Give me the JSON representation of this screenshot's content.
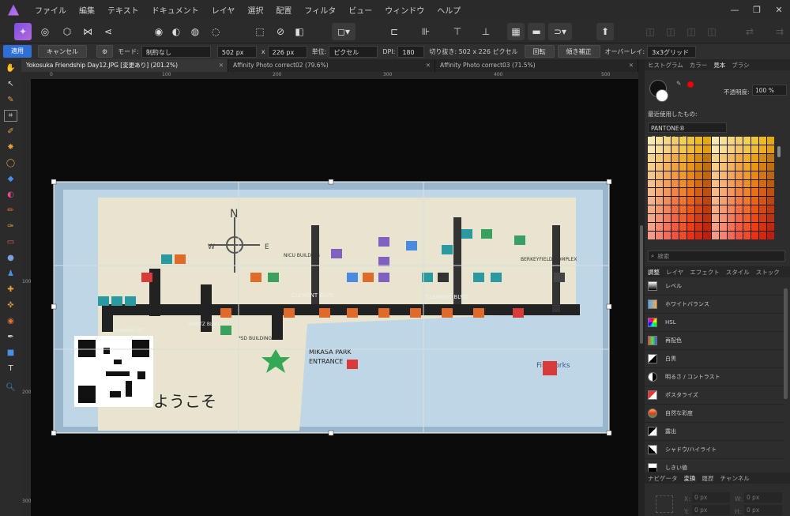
{
  "menu": {
    "items": [
      "ファイル",
      "編集",
      "テキスト",
      "ドキュメント",
      "レイヤ",
      "選択",
      "配置",
      "フィルタ",
      "ビュー",
      "ウィンドウ",
      "ヘルプ"
    ]
  },
  "context": {
    "apply_label": "適用",
    "cancel_label": "キャンセル",
    "mode_label": "モード:",
    "mode_value": "制約なし",
    "width_value": "502 px",
    "x_label": "x",
    "height_value": "226 px",
    "unit_label": "単位:",
    "unit_value": "ピクセル",
    "dpi_label": "DPI:",
    "dpi_value": "180",
    "crop_info": "切り抜き: 502 x 226 ピクセル",
    "rotate_label": "回転",
    "straighten_label": "傾き補正",
    "overlay_label": "オーバーレイ:",
    "overlay_value": "3x3グリッド"
  },
  "tabs": [
    {
      "label": "Yokosuka Friendship Day12.JPG [変更あり] (201.2%)"
    },
    {
      "label": "Affinity Photo correct02 (79.6%)"
    },
    {
      "label": "Affinity Photo correct03 (71.5%)"
    }
  ],
  "ruler": {
    "h": [
      "0",
      "100",
      "200",
      "300",
      "400",
      "500"
    ],
    "v": [
      "100",
      "200",
      "300"
    ]
  },
  "map": {
    "labels": {
      "n": "N",
      "e": "E",
      "s": "S",
      "w": "W",
      "clement1": "CLEMENT BLVD",
      "clement2": "CLEMENT BLVD",
      "nimitz": "NIMITZ BLVD",
      "howard": "HOWARD ST.",
      "mikasa": "MIKASA PARK",
      "entrance": "ENTRANCE",
      "nicu": "NICU BUILDING",
      "psd": "PSD BUILDING",
      "berkey": "BERKEYFIELD COMPLEX",
      "fireworks": "Fireworks",
      "welcome": "ようこそ"
    }
  },
  "panel": {
    "top_tabs": [
      "ヒストグラム",
      "カラー",
      "見本",
      "ブラシ"
    ],
    "opacity_label": "不透明度:",
    "opacity_value": "100 %",
    "recent_label": "最近使用したもの:",
    "palette_value": "PANTONE® GoeBridge™",
    "search_placeholder": "検索",
    "adj_tabs": [
      "調整",
      "レイヤ",
      "エフェクト",
      "スタイル",
      "ストック"
    ],
    "adjustments": [
      "レベル",
      "ホワイトバランス",
      "HSL",
      "再配色",
      "白黒",
      "明るさ / コントラスト",
      "ポスタライズ",
      "自然な彩度",
      "露出",
      "シャドウ/ハイライト",
      "しきい値"
    ],
    "bottom_tabs": [
      "ナビゲータ",
      "変換",
      "履歴",
      "チャンネル"
    ],
    "x_label": "X:",
    "x_value": "0 px",
    "w_label": "W:",
    "w_value": "0 px",
    "y_label": "Y:",
    "y_value": "0 px",
    "h_label": "H:",
    "h_value": "0 px"
  },
  "colors": {
    "accent": "#2f6fd6"
  }
}
